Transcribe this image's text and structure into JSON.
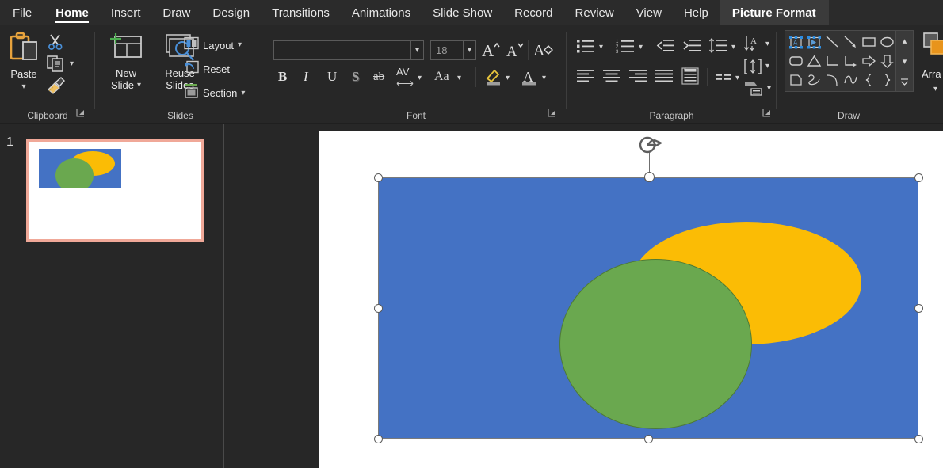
{
  "tabs": [
    {
      "label": "File",
      "state": "normal"
    },
    {
      "label": "Home",
      "state": "active"
    },
    {
      "label": "Insert",
      "state": "normal"
    },
    {
      "label": "Draw",
      "state": "normal"
    },
    {
      "label": "Design",
      "state": "normal"
    },
    {
      "label": "Transitions",
      "state": "normal"
    },
    {
      "label": "Animations",
      "state": "normal"
    },
    {
      "label": "Slide Show",
      "state": "normal"
    },
    {
      "label": "Record",
      "state": "normal"
    },
    {
      "label": "Review",
      "state": "normal"
    },
    {
      "label": "View",
      "state": "normal"
    },
    {
      "label": "Help",
      "state": "normal"
    },
    {
      "label": "Picture Format",
      "state": "contextual"
    }
  ],
  "ribbon": {
    "groups": [
      {
        "name": "clipboard",
        "label": "Clipboard"
      },
      {
        "name": "slides",
        "label": "Slides"
      },
      {
        "name": "font",
        "label": "Font"
      },
      {
        "name": "paragraph",
        "label": "Paragraph"
      },
      {
        "name": "drawing",
        "label": "Draw"
      }
    ],
    "clipboard": {
      "paste_label": "Paste",
      "cut_icon": "scissors-icon",
      "copy_icon": "copy-icon",
      "format_painter_icon": "format-painter-icon",
      "paste_icon": "clipboard-icon"
    },
    "slides": {
      "new_slide_line1": "New",
      "new_slide_line2": "Slide",
      "reuse_line1": "Reuse",
      "reuse_line2": "Slides",
      "layout_label": "Layout",
      "reset_label": "Reset",
      "section_label": "Section"
    },
    "font": {
      "font_name_value": "",
      "font_name_placeholder": "",
      "font_size_value": "18",
      "grow_font_icon": "increase-font-size-icon",
      "shrink_font_icon": "decrease-font-size-icon",
      "clear_format_icon": "clear-formatting-icon",
      "bold_label": "B",
      "italic_label": "I",
      "underline_label": "U",
      "shadow_label": "S",
      "strikethrough_label": "ab",
      "char_spacing_label": "AV",
      "change_case_label": "Aa",
      "highlight_icon": "text-highlight-icon",
      "font_color_label": "A"
    },
    "paragraph": {
      "bullets_icon": "bullets-icon",
      "numbering_icon": "numbering-icon",
      "decrease_indent_icon": "decrease-indent-icon",
      "increase_indent_icon": "increase-indent-icon",
      "line_spacing_icon": "line-spacing-icon",
      "align_left_icon": "align-left-icon",
      "align_center_icon": "align-center-icon",
      "align_right_icon": "align-right-icon",
      "justify_icon": "justify-icon",
      "columns_icon": "columns-icon",
      "text_direction_icon": "text-direction-icon",
      "align_text_icon": "align-text-icon",
      "smartart_icon": "convert-to-smartart-icon"
    },
    "drawing": {
      "arrange_label": "Arra",
      "shapes": [
        [
          "textbox-shape",
          "arrow-textbox-shape",
          "line-shape",
          "arrow-line-shape",
          "rectangle-shape",
          "ellipse-shape"
        ],
        [
          "rounded-rectangle-shape",
          "triangle-shape",
          "elbow-connector-shape",
          "elbow-arrow-connector-shape",
          "right-arrow-shape",
          "down-arrow-shape"
        ],
        [
          "folded-corner-shape",
          "scribble-shape",
          "arc-shape",
          "curve-shape",
          "left-brace-shape",
          "right-brace-shape"
        ]
      ],
      "scroll_up_icon": "chevron-up-icon",
      "scroll_down_icon": "chevron-down-icon",
      "scroll_more_icon": "chevron-double-down-icon",
      "quick_styles_icon": "shape-quick-styles-icon"
    }
  },
  "thumbnails": {
    "items": [
      {
        "number": "1",
        "selected": true
      }
    ]
  },
  "slide": {
    "picture": {
      "background_color": "#4472c4",
      "shapes": [
        {
          "name": "yellow-ellipse",
          "color": "#fbbc05"
        },
        {
          "name": "green-ellipse",
          "color": "#6aa84f",
          "stroke": "#4e7a36"
        }
      ]
    },
    "selection": {
      "handle_names": [
        "resize-handle-top-left",
        "resize-handle-top-center",
        "resize-handle-top-right",
        "resize-handle-middle-left",
        "resize-handle-middle-right",
        "resize-handle-bottom-left",
        "resize-handle-bottom-center",
        "resize-handle-bottom-right"
      ],
      "rotation_handle": "rotation-handle"
    }
  },
  "colors": {
    "ribbon_bg": "#272727",
    "tab_bg": "#2b2b2b",
    "contextual_tab_bg": "#3b3b3b",
    "thumb_selection": "#f0a898",
    "slide_blue": "#4472c4",
    "slide_yellow": "#fbbc05",
    "slide_green": "#6aa84f"
  }
}
